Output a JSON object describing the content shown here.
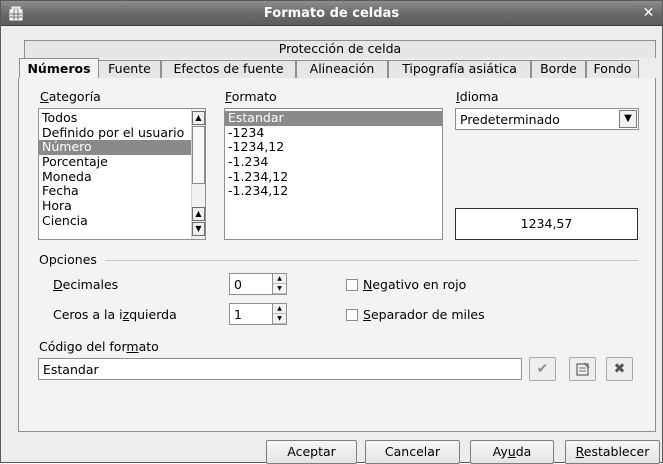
{
  "window": {
    "title": "Formato de celdas"
  },
  "tabs": {
    "row1": [
      "Protección de celda"
    ],
    "row2": [
      "Números",
      "Fuente",
      "Efectos de fuente",
      "Alineación",
      "Tipografía asiática",
      "Borde",
      "Fondo"
    ],
    "active": "Números"
  },
  "categoria": {
    "label": "Categoría",
    "items": [
      "Todos",
      "Definido por el usuario",
      "Número",
      "Porcentaje",
      "Moneda",
      "Fecha",
      "Hora",
      "Ciencia"
    ],
    "selected": "Número"
  },
  "formato": {
    "label": "Formato",
    "items": [
      "Estandar",
      "-1234",
      "-1234,12",
      "-1.234",
      "-1.234,12",
      "-1.234,12"
    ],
    "selected": "Estandar"
  },
  "idioma": {
    "label": "Idioma",
    "value": "Predeterminado"
  },
  "preview": {
    "value": "1234,57"
  },
  "opciones": {
    "section_label": "Opciones",
    "decimales_label": "Decimales",
    "decimales_value": "0",
    "ceros_label": "Ceros a la izquierda",
    "ceros_value": "1",
    "negativo_label": "Negativo en rojo",
    "negativo_checked": false,
    "separador_label": "Separador de miles",
    "separador_checked": false
  },
  "codigo": {
    "label": "Código del formato",
    "value": "Estandar"
  },
  "buttons": {
    "aceptar": "Aceptar",
    "cancelar": "Cancelar",
    "ayuda": "Ayuda",
    "restablecer": "Restablecer"
  },
  "icons": {
    "app": "spreadsheet-icon",
    "close": "close-icon",
    "accept_code": "checkmark-icon",
    "edit_comment": "edit-comment-icon",
    "delete_code": "delete-x-icon"
  }
}
